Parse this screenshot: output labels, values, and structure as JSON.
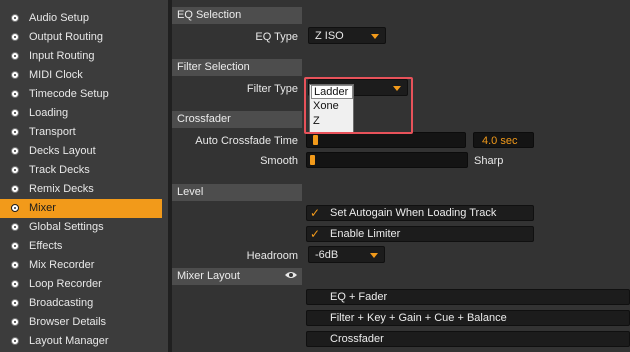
{
  "sidebar": {
    "items": [
      {
        "label": "Audio Setup"
      },
      {
        "label": "Output Routing"
      },
      {
        "label": "Input Routing"
      },
      {
        "label": "MIDI Clock"
      },
      {
        "label": "Timecode Setup"
      },
      {
        "label": "Loading"
      },
      {
        "label": "Transport"
      },
      {
        "label": "Decks Layout"
      },
      {
        "label": "Track Decks"
      },
      {
        "label": "Remix Decks"
      },
      {
        "label": "Mixer"
      },
      {
        "label": "Global Settings"
      },
      {
        "label": "Effects"
      },
      {
        "label": "Mix Recorder"
      },
      {
        "label": "Loop Recorder"
      },
      {
        "label": "Broadcasting"
      },
      {
        "label": "Browser Details"
      },
      {
        "label": "Layout Manager"
      }
    ],
    "selected": "Mixer"
  },
  "eq_selection": {
    "header": "EQ Selection",
    "eq_type_label": "EQ Type",
    "eq_type_value": "Z ISO"
  },
  "filter_selection": {
    "header": "Filter Selection",
    "filter_type_label": "Filter Type",
    "options": [
      "Ladder",
      "Xone",
      "Z"
    ],
    "highlighted": "Ladder"
  },
  "crossfader": {
    "header": "Crossfader",
    "auto_crossfade_label": "Auto Crossfade Time",
    "auto_crossfade_value": "4.0 sec",
    "auto_crossfade_level": 0.02,
    "smooth_label": "Smooth",
    "sharp_label": "Sharp",
    "curve_level": 0.0
  },
  "level": {
    "header": "Level",
    "autogain_label": "Set Autogain When Loading Track",
    "autogain_checked": true,
    "limiter_label": "Enable Limiter",
    "limiter_checked": true,
    "headroom_label": "Headroom",
    "headroom_value": "-6dB"
  },
  "mixer_layout": {
    "header": "Mixer Layout",
    "options": [
      {
        "label": "EQ + Fader",
        "checked": false
      },
      {
        "label": "Filter + Key + Gain + Cue + Balance",
        "checked": false
      },
      {
        "label": "Crossfader",
        "checked": false
      }
    ]
  },
  "colors": {
    "accent": "#f29a1a",
    "highlight_box": "#e8525a"
  }
}
